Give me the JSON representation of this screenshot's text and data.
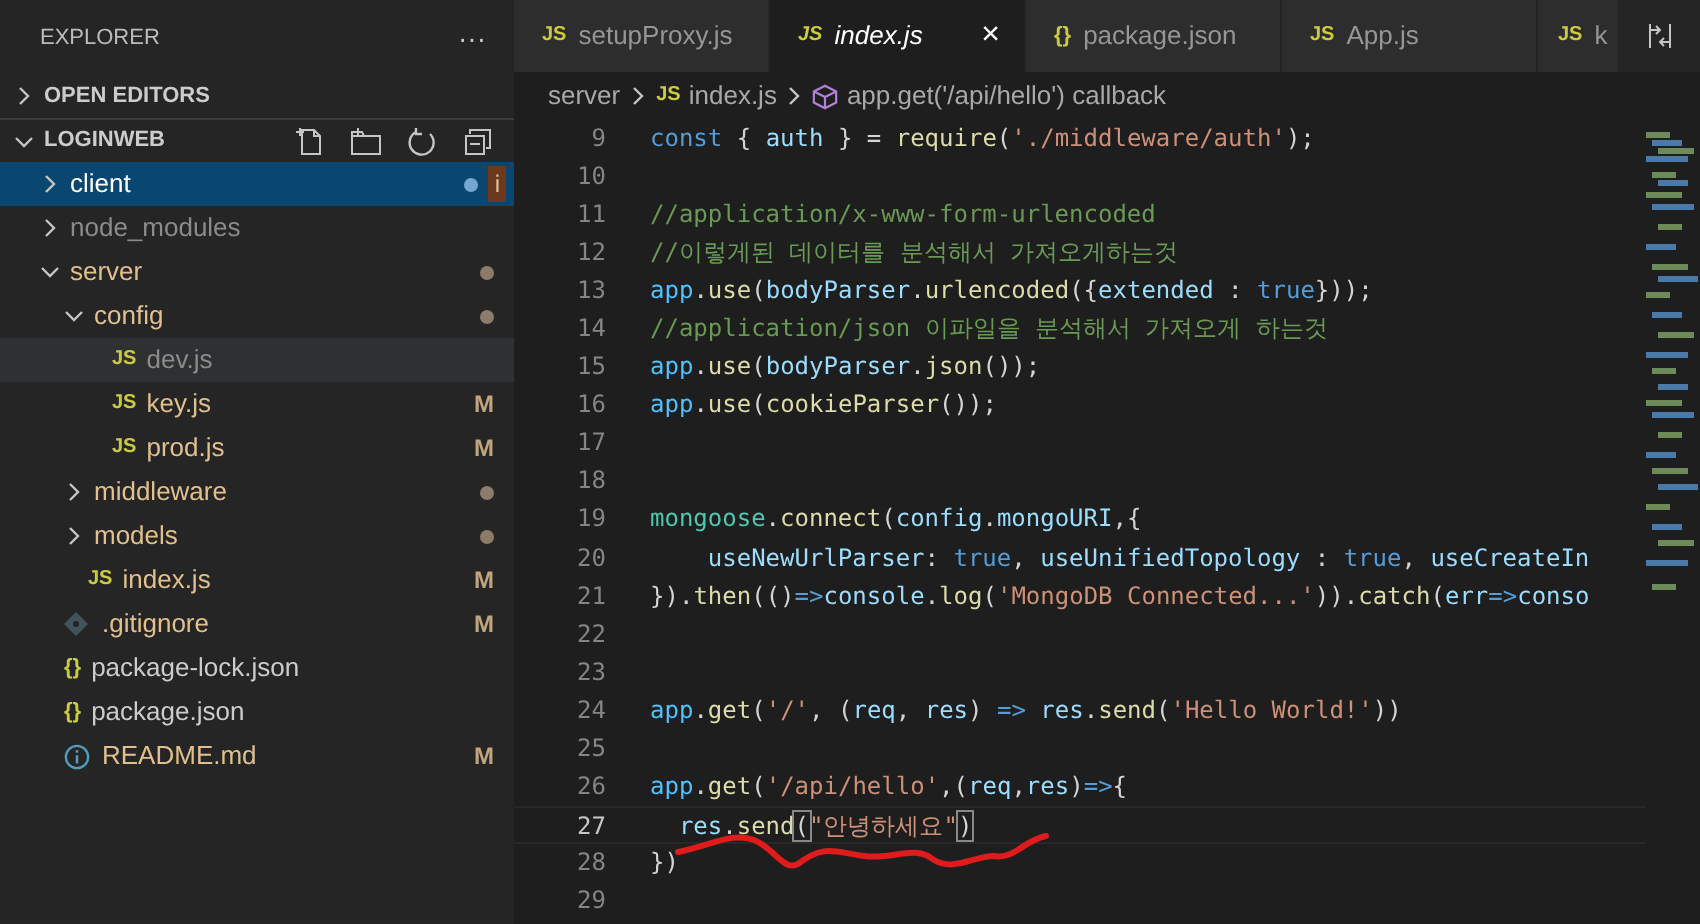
{
  "sidebar": {
    "title": "EXPLORER",
    "more": "···",
    "sections": [
      {
        "label": "OPEN EDITORS",
        "expanded": false
      },
      {
        "label": "LOGINWEB",
        "expanded": true
      }
    ],
    "tree": [
      {
        "name": "client",
        "kind": "folder",
        "expanded": false,
        "selected": true,
        "muted": false,
        "modified": false,
        "dot": true,
        "badge": "i"
      },
      {
        "name": "node_modules",
        "kind": "folder",
        "expanded": false,
        "selected": false,
        "muted": true,
        "modified": false,
        "dot": false
      },
      {
        "name": "server",
        "kind": "folder",
        "expanded": true,
        "selected": false,
        "muted": false,
        "modified": true,
        "dot": true,
        "children": [
          {
            "name": "config",
            "kind": "folder",
            "expanded": true,
            "selected": false,
            "muted": false,
            "modified": true,
            "dot": true,
            "children": [
              {
                "name": "dev.js",
                "kind": "js",
                "icon": "JS",
                "selected": false,
                "muted": true,
                "modified": false,
                "dot": false,
                "hover": true
              },
              {
                "name": "key.js",
                "kind": "js",
                "icon": "JS",
                "selected": false,
                "muted": false,
                "modified": true,
                "dot": false,
                "status": "M"
              },
              {
                "name": "prod.js",
                "kind": "js",
                "icon": "JS",
                "selected": false,
                "muted": false,
                "modified": true,
                "dot": false,
                "status": "M"
              }
            ]
          },
          {
            "name": "middleware",
            "kind": "folder",
            "expanded": false,
            "selected": false,
            "muted": false,
            "modified": true,
            "dot": true
          },
          {
            "name": "models",
            "kind": "folder",
            "expanded": false,
            "selected": false,
            "muted": false,
            "modified": true,
            "dot": true
          },
          {
            "name": "index.js",
            "kind": "js",
            "icon": "JS",
            "selected": false,
            "muted": false,
            "modified": true,
            "dot": false,
            "status": "M"
          }
        ]
      },
      {
        "name": ".gitignore",
        "kind": "git",
        "selected": false,
        "muted": false,
        "modified": true,
        "dot": false,
        "status": "M"
      },
      {
        "name": "package-lock.json",
        "kind": "json",
        "icon": "{}",
        "selected": false,
        "muted": false,
        "modified": false,
        "dot": false
      },
      {
        "name": "package.json",
        "kind": "json",
        "icon": "{}",
        "selected": false,
        "muted": false,
        "modified": false,
        "dot": false
      },
      {
        "name": "README.md",
        "kind": "info",
        "selected": false,
        "muted": false,
        "modified": true,
        "dot": false,
        "status": "M"
      }
    ]
  },
  "tabs": [
    {
      "label": "setupProxy.js",
      "kind": "js",
      "icon": "JS",
      "selected": false
    },
    {
      "label": "index.js",
      "kind": "js",
      "icon": "JS",
      "selected": true,
      "close": "×"
    },
    {
      "label": "package.json",
      "kind": "json",
      "icon": "{}",
      "selected": false
    },
    {
      "label": "App.js",
      "kind": "js",
      "icon": "JS",
      "selected": false
    },
    {
      "label": "k",
      "kind": "js",
      "icon": "JS",
      "selected": false
    }
  ],
  "breadcrumb": [
    {
      "label": "server",
      "kind": "folder"
    },
    {
      "label": "index.js",
      "kind": "js",
      "icon": "JS"
    },
    {
      "label": "app.get('/api/hello') callback",
      "kind": "symbol"
    }
  ],
  "code": [
    {
      "num": "9",
      "active": false,
      "segments": [
        {
          "text": "const",
          "kind": "keyword"
        },
        {
          "text": " { ",
          "kind": "plain"
        },
        {
          "text": "auth",
          "kind": "variable"
        },
        {
          "text": " } = ",
          "kind": "plain"
        },
        {
          "text": "require",
          "kind": "function"
        },
        {
          "text": "(",
          "kind": "plain"
        },
        {
          "text": "'./middleware/auth'",
          "kind": "string"
        },
        {
          "text": ");",
          "kind": "plain"
        }
      ]
    },
    {
      "num": "10",
      "active": false
    },
    {
      "num": "11",
      "active": false,
      "segments": [
        {
          "text": "//application/x-www-form-urlencoded",
          "kind": "comment"
        }
      ]
    },
    {
      "num": "12",
      "active": false,
      "segments": [
        {
          "text": "//이렇게된 데이터를 분석해서 가져오게하는것",
          "kind": "comment"
        }
      ]
    },
    {
      "num": "13",
      "active": false,
      "segments": [
        {
          "text": "app",
          "kind": "constant"
        },
        {
          "text": ".",
          "kind": "plain"
        },
        {
          "text": "use",
          "kind": "function"
        },
        {
          "text": "(",
          "kind": "plain"
        },
        {
          "text": "bodyParser",
          "kind": "variable"
        },
        {
          "text": ".",
          "kind": "plain"
        },
        {
          "text": "urlencoded",
          "kind": "function"
        },
        {
          "text": "({",
          "kind": "plain"
        },
        {
          "text": "extended",
          "kind": "variable"
        },
        {
          "text": " : ",
          "kind": "plain"
        },
        {
          "text": "true",
          "kind": "keyword"
        },
        {
          "text": "}));",
          "kind": "plain"
        }
      ]
    },
    {
      "num": "14",
      "active": false,
      "segments": [
        {
          "text": "//application/json 이파일을 분석해서 가져오게 하는것",
          "kind": "comment"
        }
      ]
    },
    {
      "num": "15",
      "active": false,
      "segments": [
        {
          "text": "app",
          "kind": "constant"
        },
        {
          "text": ".",
          "kind": "plain"
        },
        {
          "text": "use",
          "kind": "function"
        },
        {
          "text": "(",
          "kind": "plain"
        },
        {
          "text": "bodyParser",
          "kind": "variable"
        },
        {
          "text": ".",
          "kind": "plain"
        },
        {
          "text": "json",
          "kind": "function"
        },
        {
          "text": "());",
          "kind": "plain"
        }
      ]
    },
    {
      "num": "16",
      "active": false,
      "segments": [
        {
          "text": "app",
          "kind": "constant"
        },
        {
          "text": ".",
          "kind": "plain"
        },
        {
          "text": "use",
          "kind": "function"
        },
        {
          "text": "(",
          "kind": "plain"
        },
        {
          "text": "cookieParser",
          "kind": "function"
        },
        {
          "text": "());",
          "kind": "plain"
        }
      ]
    },
    {
      "num": "17",
      "active": false
    },
    {
      "num": "18",
      "active": false
    },
    {
      "num": "19",
      "active": false,
      "segments": [
        {
          "text": "mongoose",
          "kind": "class"
        },
        {
          "text": ".",
          "kind": "plain"
        },
        {
          "text": "connect",
          "kind": "function"
        },
        {
          "text": "(",
          "kind": "plain"
        },
        {
          "text": "config",
          "kind": "variable"
        },
        {
          "text": ".",
          "kind": "plain"
        },
        {
          "text": "mongoURI",
          "kind": "variable"
        },
        {
          "text": ",{",
          "kind": "plain"
        }
      ]
    },
    {
      "num": "20",
      "active": false,
      "segments": [
        {
          "text": "    useNewUrlParser",
          "kind": "variable"
        },
        {
          "text": ": ",
          "kind": "plain"
        },
        {
          "text": "true",
          "kind": "keyword"
        },
        {
          "text": ", ",
          "kind": "plain"
        },
        {
          "text": "useUnifiedTopology",
          "kind": "variable"
        },
        {
          "text": " : ",
          "kind": "plain"
        },
        {
          "text": "true",
          "kind": "keyword"
        },
        {
          "text": ", ",
          "kind": "plain"
        },
        {
          "text": "useCreateIn",
          "kind": "variable"
        }
      ]
    },
    {
      "num": "21",
      "active": false,
      "segments": [
        {
          "text": "}).",
          "kind": "plain"
        },
        {
          "text": "then",
          "kind": "function"
        },
        {
          "text": "(()",
          "kind": "plain"
        },
        {
          "text": "=>",
          "kind": "keyword"
        },
        {
          "text": "console",
          "kind": "variable"
        },
        {
          "text": ".",
          "kind": "plain"
        },
        {
          "text": "log",
          "kind": "function"
        },
        {
          "text": "(",
          "kind": "plain"
        },
        {
          "text": "'MongoDB Connected...'",
          "kind": "string"
        },
        {
          "text": ")).",
          "kind": "plain"
        },
        {
          "text": "catch",
          "kind": "function"
        },
        {
          "text": "(",
          "kind": "plain"
        },
        {
          "text": "err",
          "kind": "variable"
        },
        {
          "text": "=>",
          "kind": "keyword"
        },
        {
          "text": "conso",
          "kind": "variable"
        }
      ]
    },
    {
      "num": "22",
      "active": false
    },
    {
      "num": "23",
      "active": false
    },
    {
      "num": "24",
      "active": false,
      "segments": [
        {
          "text": "app",
          "kind": "constant"
        },
        {
          "text": ".",
          "kind": "plain"
        },
        {
          "text": "get",
          "kind": "function"
        },
        {
          "text": "(",
          "kind": "plain"
        },
        {
          "text": "'/'",
          "kind": "string"
        },
        {
          "text": ", (",
          "kind": "plain"
        },
        {
          "text": "req",
          "kind": "variable"
        },
        {
          "text": ", ",
          "kind": "plain"
        },
        {
          "text": "res",
          "kind": "variable"
        },
        {
          "text": ") ",
          "kind": "plain"
        },
        {
          "text": "=>",
          "kind": "keyword"
        },
        {
          "text": " res",
          "kind": "variable"
        },
        {
          "text": ".",
          "kind": "plain"
        },
        {
          "text": "send",
          "kind": "function"
        },
        {
          "text": "(",
          "kind": "plain"
        },
        {
          "text": "'Hello World!'",
          "kind": "string"
        },
        {
          "text": "))",
          "kind": "plain"
        }
      ]
    },
    {
      "num": "25",
      "active": false
    },
    {
      "num": "26",
      "active": false,
      "segments": [
        {
          "text": "app",
          "kind": "constant"
        },
        {
          "text": ".",
          "kind": "plain"
        },
        {
          "text": "get",
          "kind": "function"
        },
        {
          "text": "(",
          "kind": "plain"
        },
        {
          "text": "'/api/hello'",
          "kind": "string"
        },
        {
          "text": ",(",
          "kind": "plain"
        },
        {
          "text": "req",
          "kind": "variable"
        },
        {
          "text": ",",
          "kind": "plain"
        },
        {
          "text": "res",
          "kind": "variable"
        },
        {
          "text": ")",
          "kind": "plain"
        },
        {
          "text": "=>",
          "kind": "keyword"
        },
        {
          "text": "{",
          "kind": "plain"
        }
      ]
    },
    {
      "num": "27",
      "active": true,
      "segments": [
        {
          "text": "  res",
          "kind": "variable"
        },
        {
          "text": ".",
          "kind": "plain"
        },
        {
          "text": "send",
          "kind": "function"
        },
        {
          "text": "(",
          "kind": "bracket"
        },
        {
          "text": "\"안녕하세요\"",
          "kind": "string"
        },
        {
          "text": ")",
          "kind": "bracket"
        }
      ]
    },
    {
      "num": "28",
      "active": false,
      "segments": [
        {
          "text": "})",
          "kind": "plain"
        }
      ]
    },
    {
      "num": "29",
      "active": false
    }
  ]
}
